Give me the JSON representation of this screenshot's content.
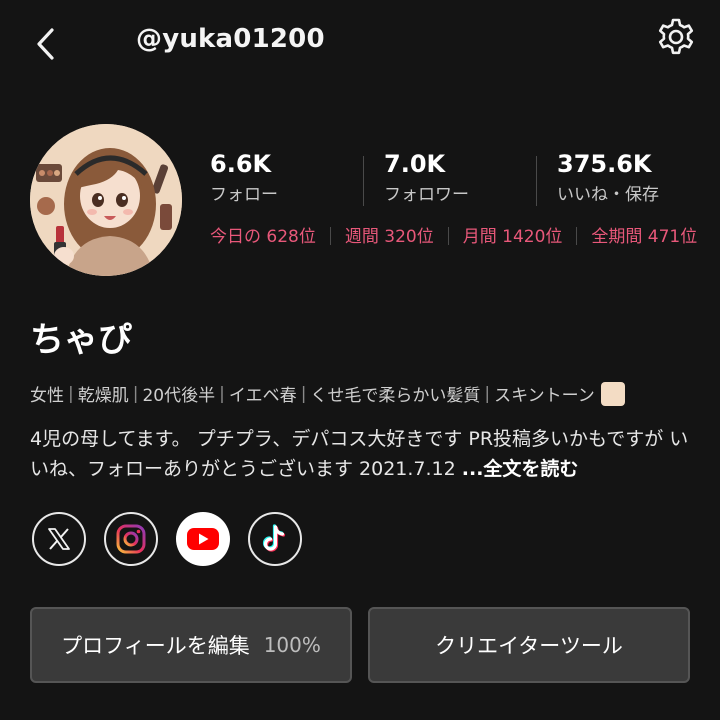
{
  "header": {
    "username": "@yuka01200",
    "back_icon": "chevron-left-icon",
    "settings_icon": "gear-icon"
  },
  "stats": [
    {
      "value": "6.6K",
      "label": "フォロー"
    },
    {
      "value": "7.0K",
      "label": "フォロワー"
    },
    {
      "value": "375.6K",
      "label": "いいね・保存"
    }
  ],
  "ranks": [
    {
      "label": "今日の 628位"
    },
    {
      "label": "週間 320位"
    },
    {
      "label": "月間 1420位"
    },
    {
      "label": "全期間 471位"
    }
  ],
  "profile": {
    "display_name": "ちゃぴ",
    "tags": [
      "女性",
      "乾燥肌",
      "20代後半",
      "イエベ春",
      "くせ毛で柔らかい髪質",
      "スキントーン"
    ],
    "skin_tone_color": "#f3dcc4",
    "bio": "4児の母してます。 プチプラ、デパコス大好きです PR投稿多いかもですが いいね、フォローありがとうございます 2021.7.12 ",
    "read_more": "...全文を読む"
  },
  "socials": [
    {
      "name": "x-icon"
    },
    {
      "name": "instagram-icon"
    },
    {
      "name": "youtube-icon"
    },
    {
      "name": "tiktok-icon"
    }
  ],
  "buttons": {
    "edit_profile": "プロフィールを編集",
    "profile_completion": "100%",
    "creator_tools": "クリエイターツール"
  },
  "colors": {
    "background": "#141414",
    "rank_accent": "#e8587a",
    "button_bg": "#3a3a3a",
    "youtube_red": "#ff0000"
  }
}
